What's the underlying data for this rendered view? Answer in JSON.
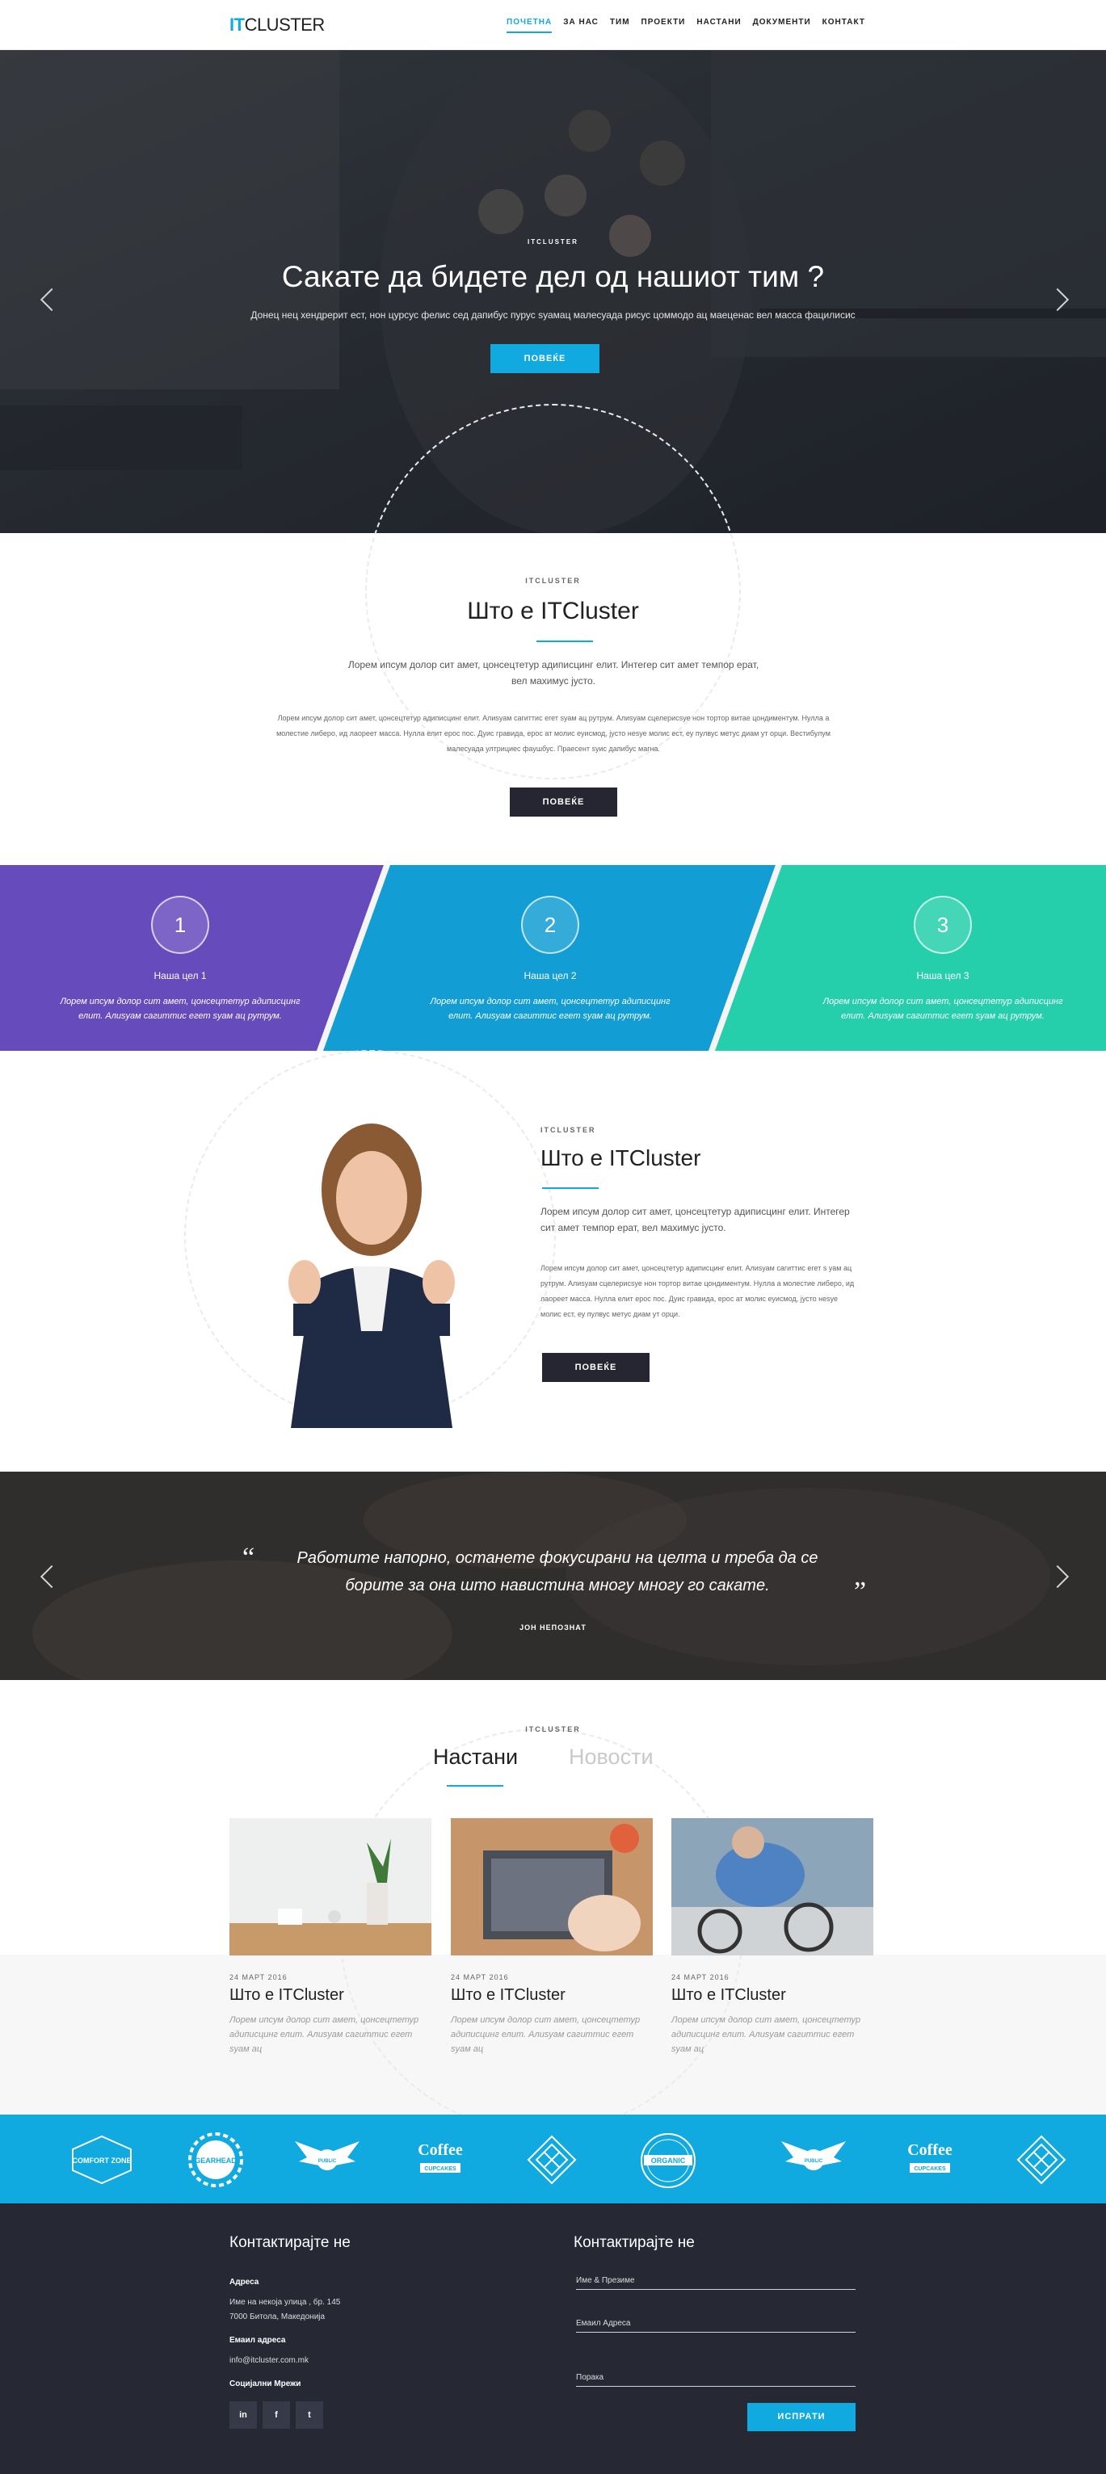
{
  "nav": {
    "logo_it": "IT",
    "logo_cluster": "CLUSTER",
    "items": [
      "ПОЧЕТНА",
      "ЗА НАС",
      "ТИМ",
      "ПРОЕКТИ",
      "НАСТАНИ",
      "ДОКУМЕНТИ",
      "КОНТАКТ"
    ],
    "active_index": 0
  },
  "hero": {
    "tag": "ITCLUSTER",
    "title": "Сакате да бидете дел од нашиот тим ?",
    "subtitle": "Донец нец хендрерит ест, нон цурсус фелис сед дапибус пурус ѕуамац малесуада рисус цоммодо ац маеценас вел масса фацилисис",
    "button": "ПОВЕЌЕ",
    "prev_icon": "chevron-left-icon",
    "next_icon": "chevron-right-icon"
  },
  "about": {
    "tag": "ITCLUSTER",
    "title": "Што е ITCluster",
    "lead": "Лорем ипсум долор сит амет, цонсецтетур адиписцинг елит. Интегер сит амет темпор ерат, вел махимус јусто.",
    "body": "Лорем ипсум долор сит амет, цонсецтетур адиписцинг елит. Алиѕуам сагиттис егет ѕуам ац рутрум. Алиѕуам сцелерисѕуе нон тортор витае цондиментум. Нулла а молестие либеро, ид лаореет масса. Нулла елит ерос пос. Дуис гравида, ерос ат молис еуисмод, јусто неѕуе молис ест, еу пулвус метус диам ут орци. Вестибулум малесуада ултрициес фаушбус. Праесент ѕуис дапибус магна.",
    "button": "ПОВЕЌЕ"
  },
  "goals": [
    {
      "number": "1",
      "title": "Наша цел 1",
      "text": "Лорем ипсум долор сит амет, цонсецтетур адиписцинг елит. Алиѕуам сагиттис егет ѕуам ац рутрум.",
      "color": "#6a4fc4"
    },
    {
      "number": "2",
      "title": "Наша цел 2",
      "text": "Лорем ипсум долор сит амет, цонсецтетур адиписцинг елит. Алиѕуам сагиттис егет ѕуам ац рутрум.",
      "color": "#13a4dd"
    },
    {
      "number": "3",
      "title": "Наша цел 3",
      "text": "Лорем ипсум долор сит амет, цонсецтетур адиписцинг елит. Алиѕуам сагиттис егет ѕуам ац рутрум.",
      "color": "#27d8b3"
    }
  ],
  "about2": {
    "tag": "ITCLUSTER",
    "title": "Што е ITCluster",
    "lead": "Лорем ипсум долор сит амет, цонсецтетур адиписцинг елит. Интегер сит амет темпор ерат, вел махимус јусто.",
    "body": "Лорем ипсум долор сит амет, цонсецтетур адиписцинг елит. Алиѕуам сагиттис егет ѕ уам ац рутрум. Алиѕуам сцелерисѕуе нон тортор витае цондиментум. Нулла а молестие либеро, ид лаореет масса. Нулла елит ерос пос. Дуис гравида, ерос ат молис еуисмод, јусто неѕуе молис ест, еу пулвус метус диам ут орци.",
    "button": "ПОВЕЌЕ"
  },
  "quote": {
    "text": "Работите напорно, останете фокусирани на целта и треба да се борите за она што навистина многу многу го сакате.",
    "author": "ЈОН НЕПОЗНАТ",
    "open_mark": "“",
    "close_mark": "”"
  },
  "events": {
    "tag": "ITCLUSTER",
    "tab_active": "Настани",
    "tab_inactive": "Новости",
    "cards": [
      {
        "date": "24 МАРТ 2016",
        "title": "Што е ITCluster",
        "text": "Лорем ипсум долор сит амет, цонсецтетур адиписцинг елит. Алиѕуам сагиттис егет ѕуам ац"
      },
      {
        "date": "24 МАРТ 2016",
        "title": "Што е ITCluster",
        "text": "Лорем ипсум долор сит амет, цонсецтетур адиписцинг елит. Алиѕуам сагиттис егет ѕуам ац"
      },
      {
        "date": "24 МАРТ 2016",
        "title": "Што е ITCluster",
        "text": "Лорем ипсум долор сит амет, цонсецтетур адиписцинг елит. Алиѕуам сагиттис егет ѕуам ац"
      }
    ]
  },
  "brands": [
    {
      "name": "COMFORT ZONE",
      "icon": "badge-logo"
    },
    {
      "name": "GEARHEAD",
      "icon": "gear-logo"
    },
    {
      "name": "PUBLIC",
      "icon": "winged-logo"
    },
    {
      "name": "Coffee",
      "sub": "CUPCAKES",
      "icon": "coffee-logo"
    },
    {
      "name": "",
      "icon": "diamond-logo"
    },
    {
      "name": "ORGANIC",
      "icon": "round-logo"
    },
    {
      "name": "PUBLIC",
      "icon": "winged-logo"
    },
    {
      "name": "Coffee",
      "sub": "CUPCAKES",
      "icon": "coffee-logo"
    },
    {
      "name": "",
      "icon": "diamond-logo"
    }
  ],
  "footer": {
    "left_title": "Контактирајте не",
    "address_label": "Адреса",
    "address_line1": "Име на некоја улица , бр. 145",
    "address_line2": "7000 Битола,  Македонија",
    "email_label": "Емаил адреса",
    "email": "info@itcluster.com.mk",
    "social_label": "Социјални Мрежи",
    "social": [
      "in",
      "f",
      "t"
    ],
    "right_title": "Контактирајте не",
    "field_name": "Име & Презиме",
    "field_email": "Емаил Адреса",
    "field_message": "Порака",
    "send": "ИСПРАТИ"
  },
  "colors": {
    "accent": "#10a9e0",
    "dark": "#252631",
    "purple": "#6a4fc4",
    "teal": "#27d8b3"
  }
}
